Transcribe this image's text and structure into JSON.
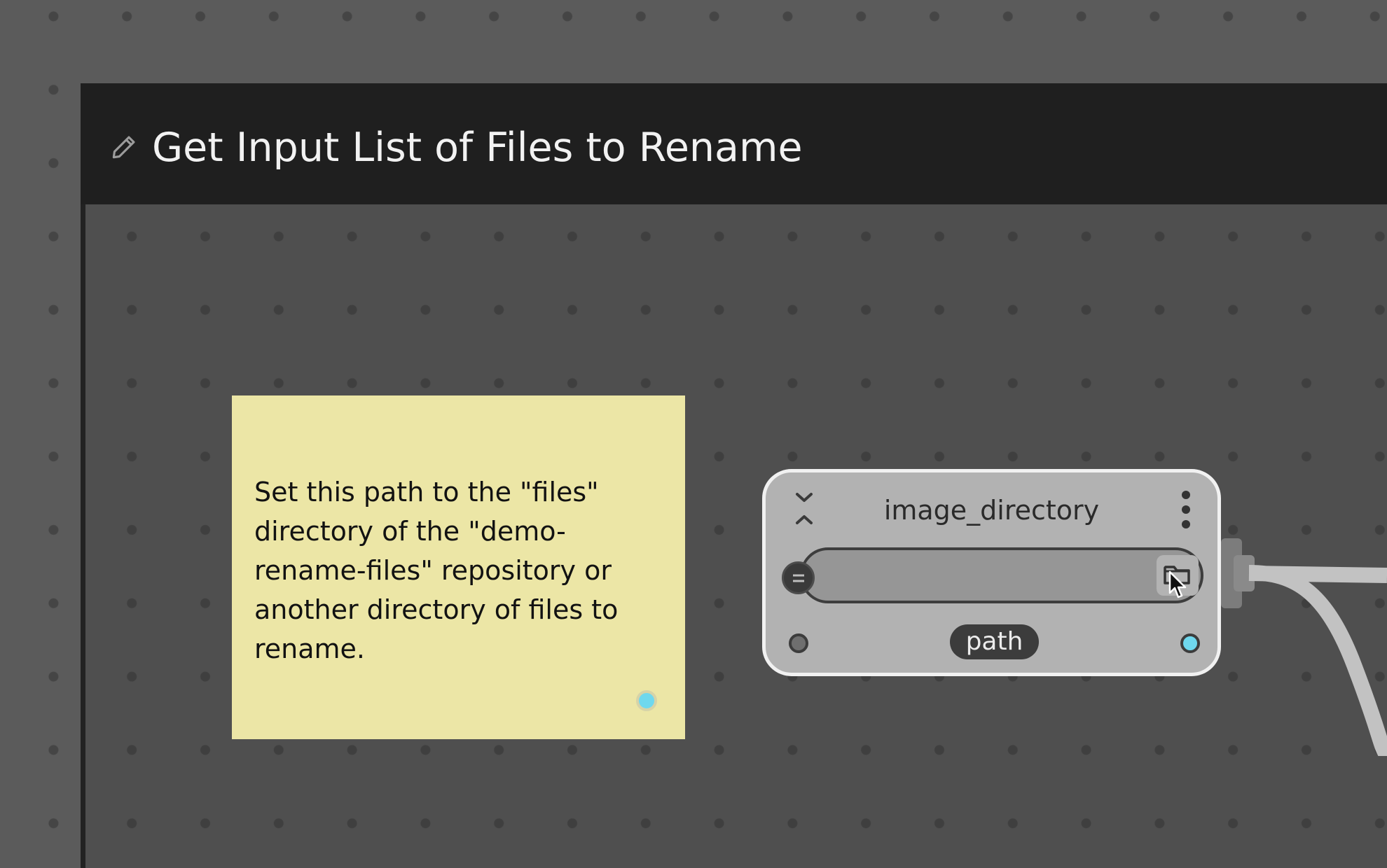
{
  "group": {
    "title": "Get Input List of Files to Rename"
  },
  "note": {
    "text": "Set this path to the \"files\" directory of the \"demo-rename-files\" repository or another directory of files to rename."
  },
  "node": {
    "title": "image_directory",
    "path_value": "",
    "type_label": "path"
  },
  "colors": {
    "canvas": "#5b5b5b",
    "group_bg": "#4f4f4f",
    "group_header": "#1f1f1f",
    "note_bg": "#ece6a6",
    "node_bg": "#b2b2b2",
    "port_accent": "#6fd8ee"
  },
  "icons": {
    "edit": "pencil-icon",
    "collapse": "chevron-collapse-icon",
    "menu": "vertical-dots-icon",
    "browse": "folder-icon",
    "linked": "equals-icon",
    "pointer": "cursor-icon"
  }
}
